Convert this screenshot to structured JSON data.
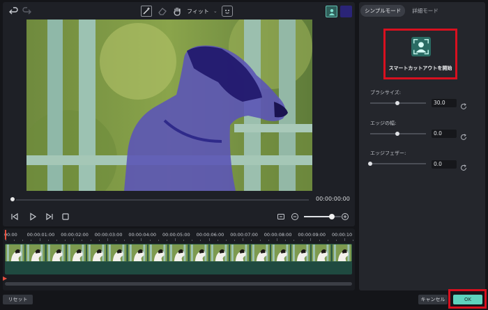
{
  "toolbar": {
    "undo_icon": "undo-icon",
    "redo_icon": "redo-icon",
    "smart_brush_icon": "magic-brush-icon",
    "eraser_icon": "eraser-icon",
    "hand_icon": "hand-icon",
    "zoom_fit_label": "フィット",
    "compare_icon": "compare-icon",
    "overlay_color": "#2a2477"
  },
  "player": {
    "timecode": "00:00:00:00",
    "progress": 0.0,
    "zoom_level": 0.75
  },
  "timeline": {
    "ruler_labels": [
      "00:00",
      "00:00:01:00",
      "00:00:02:00",
      "00:00:03:00",
      "00:00:04:00",
      "00:00:05:00",
      "00:00:06:00",
      "00:00:07:00",
      "00:00:08:00",
      "00:00:09:00",
      "00:00:10"
    ],
    "clip_thumbnail_count": 17
  },
  "right_panel": {
    "tabs": [
      "シンプルモード",
      "詳細モード"
    ],
    "active_tab": "シンプルモード",
    "cutout_button_label": "スマートカットアウトを開始",
    "params": [
      {
        "label": "ブラシサイズ:",
        "value": "30.0",
        "level": 0.49
      },
      {
        "label": "エッジの幅:",
        "value": "0.0",
        "level": 0.49
      },
      {
        "label": "エッジフェザー:",
        "value": "0.0",
        "level": 0.0
      }
    ]
  },
  "footer": {
    "reset_label": "リセット",
    "cancel_label": "キャンセル",
    "ok_label": "OK"
  },
  "colors": {
    "accent": "#5ed3be",
    "highlight": "#d8101f"
  }
}
